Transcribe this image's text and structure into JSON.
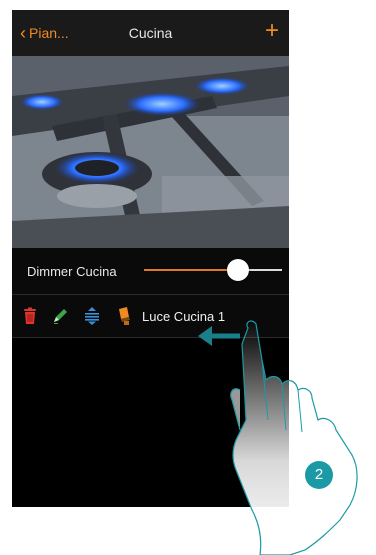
{
  "navbar": {
    "back_label": "Pian...",
    "title": "Cucina",
    "add_label": "+"
  },
  "dimmer": {
    "label": "Dimmer Cucina",
    "level": 0.68,
    "colors": {
      "fill": "#e07a26",
      "track": "#dcdcdc"
    }
  },
  "item": {
    "label": "Luce Cucina 1",
    "actions": [
      {
        "name": "delete",
        "icon": "trash-icon",
        "color": "#e0342c"
      },
      {
        "name": "edit",
        "icon": "pencil-icon",
        "color": "#3aa64a"
      },
      {
        "name": "reorder",
        "icon": "reorder-icon",
        "color": "#3a8fd8"
      },
      {
        "name": "device",
        "icon": "lamp-icon",
        "color": "#f08a24"
      }
    ]
  },
  "overlay": {
    "step_number": "2",
    "gesture": "swipe-left",
    "colors": {
      "badge": "#1b9aa6",
      "arrow": "#1b7f8a"
    }
  },
  "colors": {
    "accent": "#f08a24",
    "background": "#000000",
    "navbar": "#1a1a1a"
  }
}
